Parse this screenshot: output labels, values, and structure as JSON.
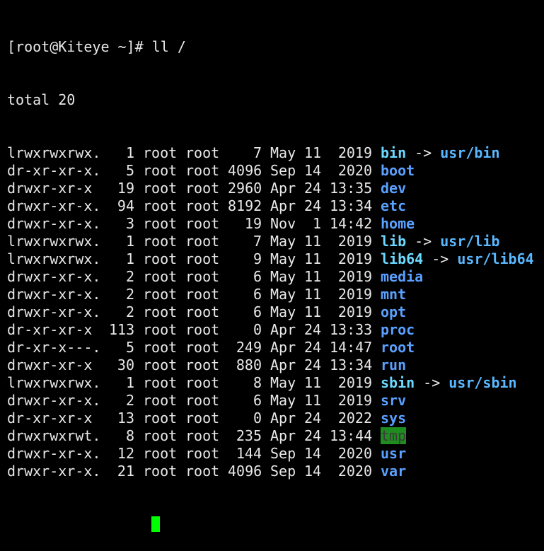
{
  "terminal": {
    "prompt": "[root@Kiteye ~]# ",
    "command": "ll /",
    "total": "total 20",
    "colors": {
      "text": "#e8e8e8",
      "directory": "#5aa0ff",
      "symlink": "#6cd9ff",
      "link_target": "#5ab8ff",
      "sticky_dir_fg": "#3c3c3c",
      "sticky_dir_bg": "#1e8c1e",
      "cursor": "#00ff00"
    },
    "entries": [
      {
        "perm": "lrwxrwxrwx.",
        "links": "1",
        "owner": "root",
        "group": "root",
        "size": "7",
        "month": "May",
        "day": "11",
        "time": "2019",
        "name": "bin",
        "type": "link",
        "target": "usr/bin"
      },
      {
        "perm": "dr-xr-xr-x.",
        "links": "5",
        "owner": "root",
        "group": "root",
        "size": "4096",
        "month": "Sep",
        "day": "14",
        "time": "2020",
        "name": "boot",
        "type": "dir"
      },
      {
        "perm": "drwxr-xr-x",
        "links": "19",
        "owner": "root",
        "group": "root",
        "size": "2960",
        "month": "Apr",
        "day": "24",
        "time": "13:35",
        "name": "dev",
        "type": "dir"
      },
      {
        "perm": "drwxr-xr-x.",
        "links": "94",
        "owner": "root",
        "group": "root",
        "size": "8192",
        "month": "Apr",
        "day": "24",
        "time": "13:34",
        "name": "etc",
        "type": "dir"
      },
      {
        "perm": "drwxr-xr-x.",
        "links": "3",
        "owner": "root",
        "group": "root",
        "size": "19",
        "month": "Nov",
        "day": "1",
        "time": "14:42",
        "name": "home",
        "type": "dir"
      },
      {
        "perm": "lrwxrwxrwx.",
        "links": "1",
        "owner": "root",
        "group": "root",
        "size": "7",
        "month": "May",
        "day": "11",
        "time": "2019",
        "name": "lib",
        "type": "link",
        "target": "usr/lib"
      },
      {
        "perm": "lrwxrwxrwx.",
        "links": "1",
        "owner": "root",
        "group": "root",
        "size": "9",
        "month": "May",
        "day": "11",
        "time": "2019",
        "name": "lib64",
        "type": "link",
        "target": "usr/lib64"
      },
      {
        "perm": "drwxr-xr-x.",
        "links": "2",
        "owner": "root",
        "group": "root",
        "size": "6",
        "month": "May",
        "day": "11",
        "time": "2019",
        "name": "media",
        "type": "dir"
      },
      {
        "perm": "drwxr-xr-x.",
        "links": "2",
        "owner": "root",
        "group": "root",
        "size": "6",
        "month": "May",
        "day": "11",
        "time": "2019",
        "name": "mnt",
        "type": "dir"
      },
      {
        "perm": "drwxr-xr-x.",
        "links": "2",
        "owner": "root",
        "group": "root",
        "size": "6",
        "month": "May",
        "day": "11",
        "time": "2019",
        "name": "opt",
        "type": "dir"
      },
      {
        "perm": "dr-xr-xr-x",
        "links": "113",
        "owner": "root",
        "group": "root",
        "size": "0",
        "month": "Apr",
        "day": "24",
        "time": "13:33",
        "name": "proc",
        "type": "dir"
      },
      {
        "perm": "dr-xr-x---.",
        "links": "5",
        "owner": "root",
        "group": "root",
        "size": "249",
        "month": "Apr",
        "day": "24",
        "time": "14:47",
        "name": "root",
        "type": "dir"
      },
      {
        "perm": "drwxr-xr-x",
        "links": "30",
        "owner": "root",
        "group": "root",
        "size": "880",
        "month": "Apr",
        "day": "24",
        "time": "13:34",
        "name": "run",
        "type": "dir"
      },
      {
        "perm": "lrwxrwxrwx.",
        "links": "1",
        "owner": "root",
        "group": "root",
        "size": "8",
        "month": "May",
        "day": "11",
        "time": "2019",
        "name": "sbin",
        "type": "link",
        "target": "usr/sbin"
      },
      {
        "perm": "drwxr-xr-x.",
        "links": "2",
        "owner": "root",
        "group": "root",
        "size": "6",
        "month": "May",
        "day": "11",
        "time": "2019",
        "name": "srv",
        "type": "dir"
      },
      {
        "perm": "dr-xr-xr-x",
        "links": "13",
        "owner": "root",
        "group": "root",
        "size": "0",
        "month": "Apr",
        "day": "24",
        "time": "2022",
        "name": "sys",
        "type": "dir"
      },
      {
        "perm": "drwxrwxrwt.",
        "links": "8",
        "owner": "root",
        "group": "root",
        "size": "235",
        "month": "Apr",
        "day": "24",
        "time": "13:44",
        "name": "tmp",
        "type": "sticky"
      },
      {
        "perm": "drwxr-xr-x.",
        "links": "12",
        "owner": "root",
        "group": "root",
        "size": "144",
        "month": "Sep",
        "day": "14",
        "time": "2020",
        "name": "usr",
        "type": "dir"
      },
      {
        "perm": "drwxr-xr-x.",
        "links": "21",
        "owner": "root",
        "group": "root",
        "size": "4096",
        "month": "Sep",
        "day": "14",
        "time": "2020",
        "name": "var",
        "type": "dir"
      }
    ]
  }
}
